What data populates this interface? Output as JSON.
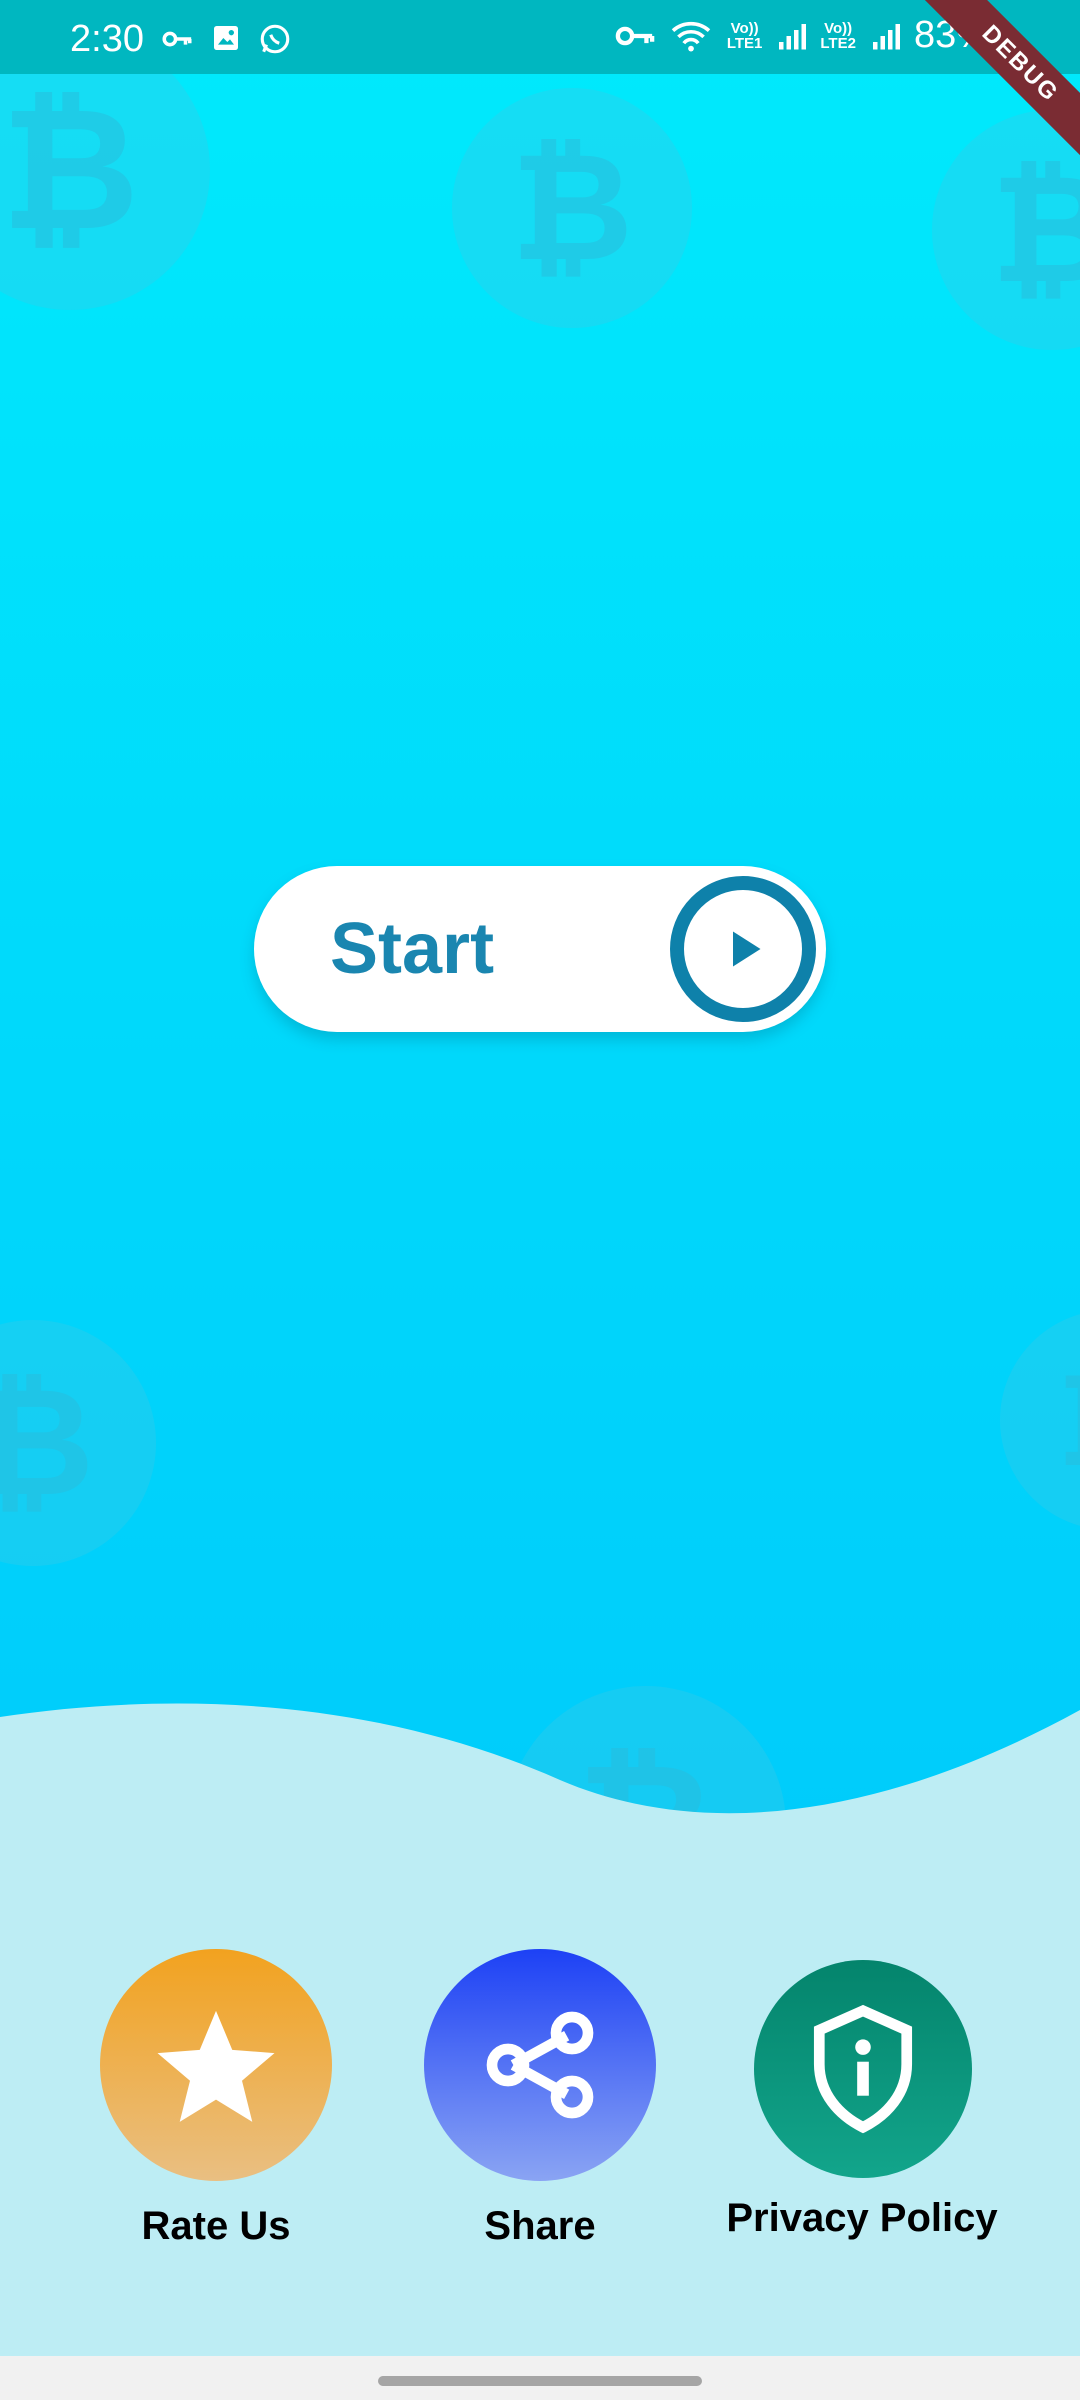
{
  "status_bar": {
    "time": "2:30",
    "battery": "83%",
    "sim1": "LTE1",
    "sim2": "LTE2",
    "volte": "Vo))"
  },
  "debug_banner": "DEBUG",
  "start_button": {
    "label": "Start"
  },
  "actions": [
    {
      "label": "Rate Us",
      "icon": "star-icon"
    },
    {
      "label": "Share",
      "icon": "share-icon"
    },
    {
      "label": "Privacy Policy",
      "icon": "shield-info-icon"
    }
  ],
  "decor": {
    "coin_symbol": "₿"
  },
  "colors": {
    "bg_top": "#00eafc",
    "bg_bottom": "#00c3fb",
    "bottom_panel": "#bdedf4",
    "start_text": "#1a86b0",
    "rate": "#f2a21f",
    "share": "#1d41f5",
    "privacy": "#04846c"
  }
}
